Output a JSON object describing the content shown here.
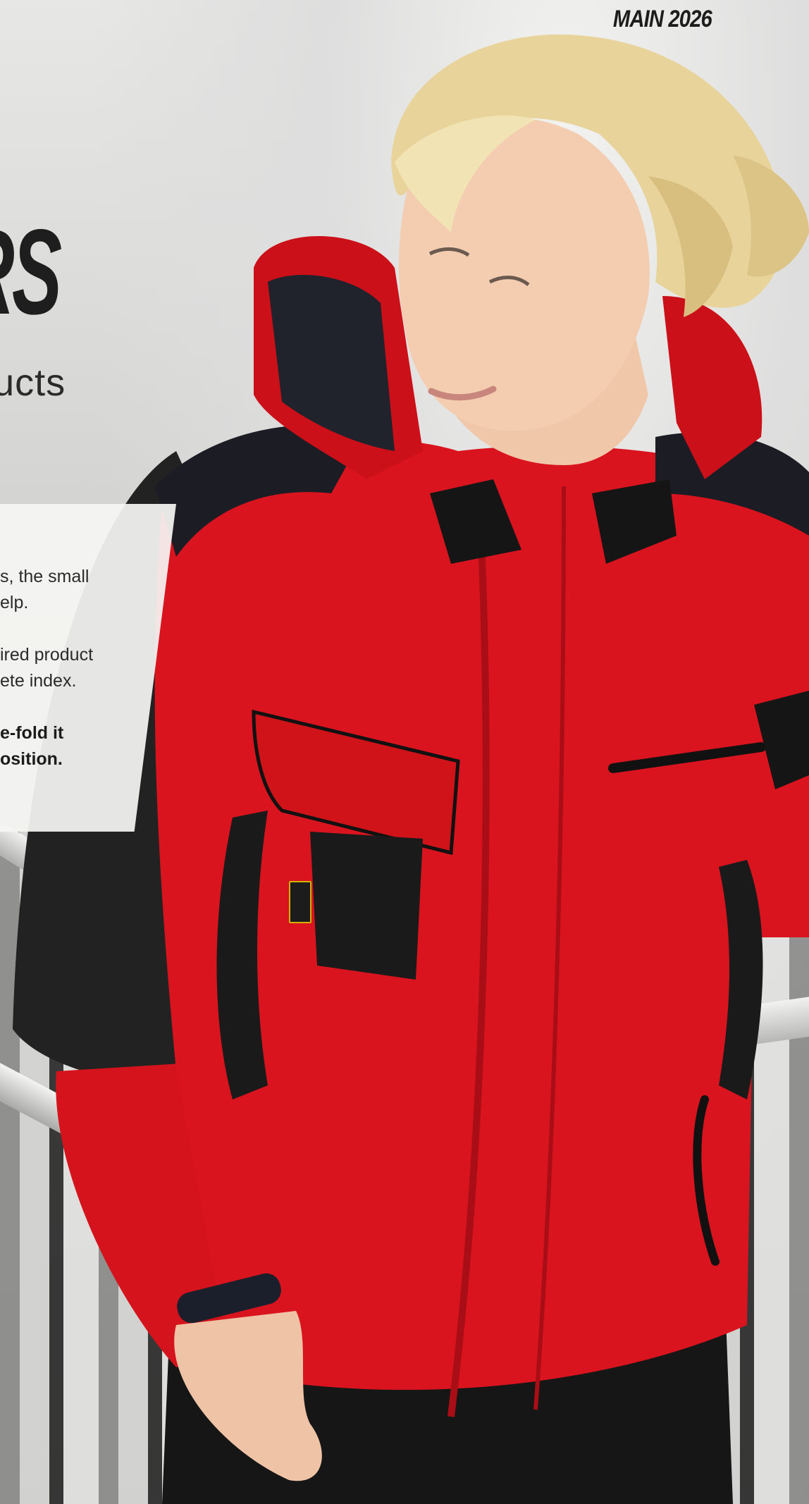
{
  "header": {
    "edition": "MAIN 2026"
  },
  "hero": {
    "title_fragment": "RS",
    "subtitle_fragment": "oducts"
  },
  "info_card": {
    "paragraph1": [
      "s, the small",
      "elp."
    ],
    "paragraph2": [
      "ired product",
      "ete index."
    ],
    "paragraph3": [
      "e-fold it",
      "osition."
    ]
  },
  "photo": {
    "subject": "woman-in-red-workwear-jacket",
    "colors": {
      "jacket_red": "#d9141e",
      "jacket_black": "#1b1b1b",
      "hair": "#e8d49a",
      "wall": "#d6d6d4"
    }
  }
}
